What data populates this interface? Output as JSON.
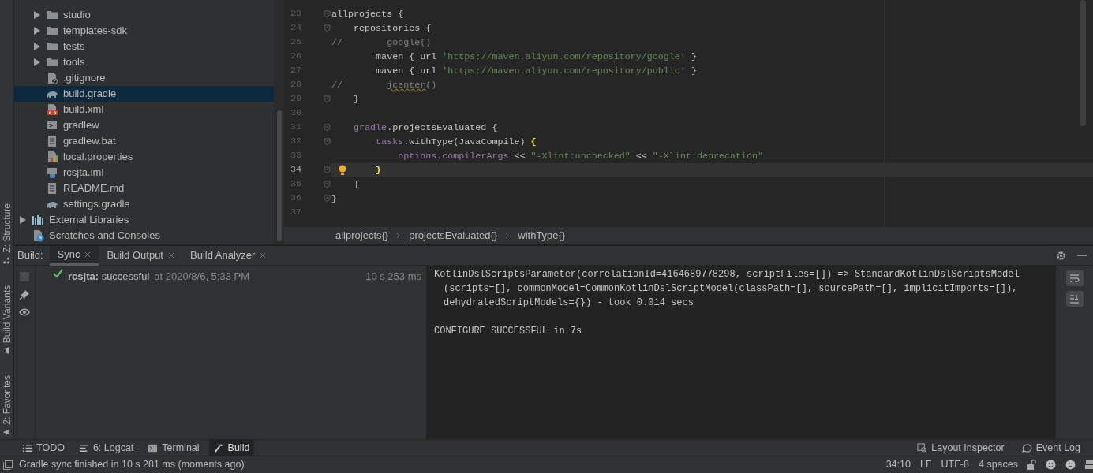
{
  "side_tabs": [
    {
      "label": "Z: Structure"
    },
    {
      "label": "Build Variants"
    },
    {
      "label": "2: Favorites"
    }
  ],
  "project_tree": [
    {
      "children": [
        {
          "label": "studio",
          "kind": "folder",
          "expandable": true,
          "selected": false
        },
        {
          "label": "templates-sdk",
          "kind": "folder",
          "expandable": true,
          "selected": false
        },
        {
          "label": "tests",
          "kind": "folder",
          "expandable": true,
          "selected": false
        },
        {
          "label": "tools",
          "kind": "folder",
          "expandable": true,
          "selected": false
        },
        {
          "label": ".gitignore",
          "kind": "ignore",
          "expandable": false,
          "selected": false
        },
        {
          "label": "build.gradle",
          "kind": "gradle",
          "expandable": false,
          "selected": true
        },
        {
          "label": "build.xml",
          "kind": "xml",
          "expandable": false,
          "selected": false
        },
        {
          "label": "gradlew",
          "kind": "script",
          "expandable": false,
          "selected": false
        },
        {
          "label": "gradlew.bat",
          "kind": "text",
          "expandable": false,
          "selected": false
        },
        {
          "label": "local.properties",
          "kind": "properties",
          "expandable": false,
          "selected": false
        },
        {
          "label": "rcsjta.iml",
          "kind": "iml",
          "expandable": false,
          "selected": false
        },
        {
          "label": "README.md",
          "kind": "text",
          "expandable": false,
          "selected": false
        },
        {
          "label": "settings.gradle",
          "kind": "gradle",
          "expandable": false,
          "selected": false
        }
      ]
    },
    {
      "label": "External Libraries",
      "kind": "libraries",
      "expandable": true,
      "selected": false
    },
    {
      "label": "Scratches and Consoles",
      "kind": "scratches",
      "expandable": false,
      "selected": false
    }
  ],
  "editor": {
    "lines": [
      {
        "number": "23",
        "fold": true,
        "current": false,
        "bulb": false,
        "tokens": [
          {
            "text": "allprojects {",
            "kind": "plain"
          }
        ]
      },
      {
        "number": "24",
        "fold": true,
        "current": false,
        "bulb": false,
        "tokens": [
          {
            "text": "    repositories {",
            "kind": "plain"
          }
        ]
      },
      {
        "number": "25",
        "fold": false,
        "current": false,
        "bulb": false,
        "tokens": [
          {
            "text": "//        google()",
            "kind": "comment"
          }
        ]
      },
      {
        "number": "26",
        "fold": false,
        "current": false,
        "bulb": false,
        "tokens": [
          {
            "text": "        maven { url ",
            "kind": "plain"
          },
          {
            "text": "'https://maven.aliyun.com/repository/google'",
            "kind": "string"
          },
          {
            "text": " }",
            "kind": "plain"
          }
        ]
      },
      {
        "number": "27",
        "fold": false,
        "current": false,
        "bulb": false,
        "tokens": [
          {
            "text": "        maven { url ",
            "kind": "plain"
          },
          {
            "text": "'https://maven.aliyun.com/repository/public'",
            "kind": "string"
          },
          {
            "text": " }",
            "kind": "plain"
          }
        ]
      },
      {
        "number": "28",
        "fold": false,
        "current": false,
        "bulb": false,
        "tokens": [
          {
            "text": "//        ",
            "kind": "comment"
          },
          {
            "text": "jcenter",
            "kind": "warning"
          },
          {
            "text": "()",
            "kind": "comment"
          }
        ]
      },
      {
        "number": "29",
        "fold": true,
        "current": false,
        "bulb": false,
        "tokens": [
          {
            "text": "    }",
            "kind": "plain"
          }
        ]
      },
      {
        "number": "30",
        "fold": false,
        "current": false,
        "bulb": false
      },
      {
        "number": "31",
        "fold": true,
        "current": false,
        "bulb": false,
        "tokens": [
          {
            "text": "    gradle",
            "kind": "field"
          },
          {
            "text": ".projectsEvaluated {",
            "kind": "plain"
          }
        ]
      },
      {
        "number": "32",
        "fold": true,
        "current": false,
        "bulb": false,
        "tokens": [
          {
            "text": "        tasks",
            "kind": "field"
          },
          {
            "text": ".withType(JavaCompile) ",
            "kind": "plain"
          },
          {
            "text": "{",
            "kind": "match"
          }
        ]
      },
      {
        "number": "33",
        "fold": false,
        "current": false,
        "bulb": false,
        "tokens": [
          {
            "text": "            options",
            "kind": "field"
          },
          {
            "text": ".",
            "kind": "plain"
          },
          {
            "text": "compilerArgs",
            "kind": "field"
          },
          {
            "text": " << ",
            "kind": "plain"
          },
          {
            "text": "\"-Xlint:unchecked\"",
            "kind": "string"
          },
          {
            "text": " << ",
            "kind": "plain"
          },
          {
            "text": "\"-Xlint:deprecation\"",
            "kind": "string"
          }
        ]
      },
      {
        "number": "34",
        "fold": true,
        "current": true,
        "bulb": true,
        "tokens": [
          {
            "text": "        }",
            "kind": "match"
          }
        ]
      },
      {
        "number": "35",
        "fold": true,
        "current": false,
        "bulb": false,
        "tokens": [
          {
            "text": "    }",
            "kind": "plain"
          }
        ]
      },
      {
        "number": "36",
        "fold": true,
        "current": false,
        "bulb": false,
        "tokens": [
          {
            "text": "}",
            "kind": "plain"
          }
        ]
      },
      {
        "number": "37",
        "fold": false,
        "current": false,
        "bulb": false
      }
    ],
    "breadcrumbs": [
      "allprojects{}",
      "projectsEvaluated{}",
      "withType{}"
    ]
  },
  "build_panel": {
    "label": "Build:",
    "tabs": [
      {
        "label": "Sync",
        "selected": true
      },
      {
        "label": "Build Output",
        "selected": false
      },
      {
        "label": "Build Analyzer",
        "selected": false
      }
    ],
    "result": {
      "title": "**rcsjta:** successful",
      "time": "at 2020/8/6, 5:33 PM",
      "duration": "10 s 253 ms"
    },
    "console": [
      {
        "lines": [
          "KotlinDslScriptsParameter(correlationId=4164689778298, scriptFiles=[]) => StandardKotlinDslScriptsModel",
          "(scripts=[], commonModel=CommonKotlinDslScriptModel(classPath=[], sourcePath=[], implicitImports=[]),",
          "dehydratedScriptModels={}) - took 0.014 secs"
        ]
      },
      {
        "lines": [
          "CONFIGURE SUCCESSFUL in 7s"
        ]
      }
    ]
  },
  "tool_windows": {
    "left": [
      {
        "label": "TODO",
        "selected": false
      },
      {
        "label": "6: Logcat",
        "selected": false
      },
      {
        "label": "Terminal",
        "selected": false
      },
      {
        "label": "Build",
        "selected": true
      }
    ],
    "right": [
      {
        "label": "Layout Inspector"
      },
      {
        "label": "Event Log"
      }
    ]
  },
  "status_bar": {
    "message": "Gradle sync finished in 10 s 281 ms (moments ago)",
    "items": [
      "34:10",
      "LF",
      "UTF-8",
      "4 spaces"
    ]
  }
}
